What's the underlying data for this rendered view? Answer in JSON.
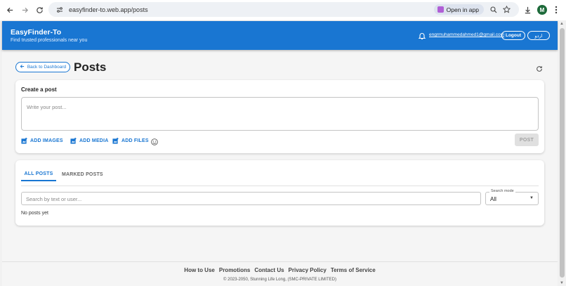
{
  "browser": {
    "url": "easyfinder-to.web.app/posts",
    "open_in_app": "Open in app",
    "profile_initial": "M"
  },
  "header": {
    "brand_title": "EasyFinder-To",
    "brand_subtitle": "Find trusted professionals near you",
    "email": "engrmuhammedahmed1@gmail.com",
    "logout": "Logout",
    "language": "اردو"
  },
  "page": {
    "back_label": "Back to Dashboard",
    "title": "Posts"
  },
  "composer": {
    "title": "Create a post",
    "placeholder": "Write your post...",
    "add_images": "ADD IMAGES",
    "add_media": "ADD MEDIA",
    "add_files": "ADD FILES",
    "post_button": "POST"
  },
  "feed": {
    "tabs": [
      {
        "label": "ALL POSTS",
        "active": true
      },
      {
        "label": "MARKED POSTS",
        "active": false
      }
    ],
    "search_placeholder": "Search by text or user...",
    "search_mode_label": "Search mode",
    "search_mode_value": "All",
    "empty_text": "No posts yet"
  },
  "footer": {
    "links": [
      "How to Use",
      "Promotions",
      "Contact Us",
      "Privacy Policy",
      "Terms of Service"
    ],
    "copyright": "© 2023-2050, Stunning Life Long, (SMC-PRIVATE LIMITED)"
  },
  "colors": {
    "primary": "#1976d2",
    "background": "#f5f5f5",
    "profile": "#1d6a3a"
  }
}
